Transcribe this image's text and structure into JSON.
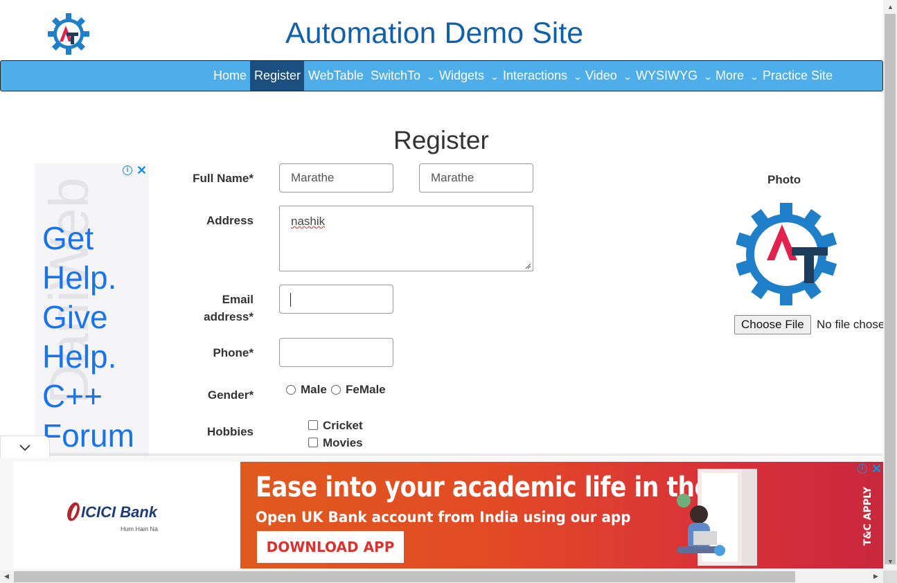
{
  "header": {
    "site_title": "Automation Demo Site"
  },
  "nav": {
    "items": [
      {
        "label": "Home",
        "dropdown": false
      },
      {
        "label": "Register",
        "dropdown": false,
        "active": true
      },
      {
        "label": "WebTable",
        "dropdown": false
      },
      {
        "label": "SwitchTo",
        "dropdown": true
      },
      {
        "label": "Widgets",
        "dropdown": true
      },
      {
        "label": "Interactions",
        "dropdown": true
      },
      {
        "label": "Video",
        "dropdown": true
      },
      {
        "label": "WYSIWYG",
        "dropdown": true
      },
      {
        "label": "More",
        "dropdown": true
      },
      {
        "label": "Practice Site",
        "dropdown": false
      }
    ],
    "active_color": "#1b4f80",
    "bar_color": "#4daeea"
  },
  "form": {
    "title": "Register",
    "full_name_label": "Full Name*",
    "first_name_value": "Marathe",
    "last_name_value": "Marathe",
    "address_label": "Address",
    "address_value": "nashik",
    "email_label_line1": "Email",
    "email_label_line2": "address*",
    "email_value": "",
    "phone_label": "Phone*",
    "phone_value": "",
    "gender_label": "Gender*",
    "gender_options": [
      "Male",
      "FeMale"
    ],
    "hobbies_label": "Hobbies",
    "hobbies_options": [
      "Cricket",
      "Movies"
    ]
  },
  "photo": {
    "label": "Photo",
    "choose_file_label": "Choose File",
    "file_status": "No file chosen"
  },
  "left_ad": {
    "text_lines": [
      "Get",
      "Help.",
      "Give",
      "Help.",
      "C++",
      "Forum"
    ],
    "watermark": "DaniWeb"
  },
  "banner_ad": {
    "advertiser": "ICICI Bank",
    "advertiser_sub": "Hum Hain Na",
    "headline": "Ease into your academic life in the UK",
    "subline": "Open UK Bank account from India using our app",
    "cta": "DOWNLOAD APP",
    "disclaimer": "T&C APPLY"
  },
  "colors": {
    "title_blue": "#1260a8",
    "ad_blue": "#1a73e8",
    "banner_red": "#d9303a",
    "logo_blue": "#1f7fc8",
    "logo_red": "#e0234e",
    "logo_navy": "#1d3d5c"
  }
}
